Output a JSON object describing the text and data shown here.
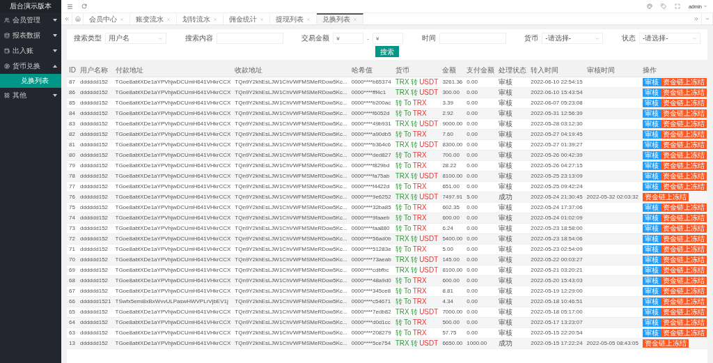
{
  "sidebar": {
    "title": "后台演示版本",
    "items": [
      {
        "label": "会员管理",
        "expanded": false
      },
      {
        "label": "报表数据",
        "expanded": false
      },
      {
        "label": "出入账",
        "expanded": false
      },
      {
        "label": "货币兑换",
        "expanded": true,
        "children": [
          {
            "label": "兑换列表",
            "selected": true
          }
        ]
      },
      {
        "label": "其他",
        "expanded": false
      }
    ]
  },
  "topbar": {
    "user": "admin"
  },
  "tabs": [
    {
      "label": "会员中心",
      "selected": false
    },
    {
      "label": "账变流水",
      "selected": false
    },
    {
      "label": "划转流水",
      "selected": false
    },
    {
      "label": "佣金统计",
      "selected": false
    },
    {
      "label": "提现列表",
      "selected": false
    },
    {
      "label": "兑换列表",
      "selected": true
    }
  ],
  "filters": [
    {
      "kind": "select",
      "label": "搜索类型",
      "value": "用户名"
    },
    {
      "kind": "input",
      "label": "搜索内容"
    },
    {
      "kind": "range",
      "label": "交易金额",
      "placeholders": [
        "¥",
        "¥"
      ],
      "separator": "-"
    },
    {
      "kind": "input",
      "label": "时间"
    },
    {
      "kind": "select",
      "label": "货币",
      "value": "-请选择-"
    },
    {
      "kind": "select",
      "label": "状态",
      "value": "-请选择-"
    }
  ],
  "search_button": "搜索",
  "table": {
    "columns": [
      "ID",
      "用户名称",
      "付款地址",
      "收款地址",
      "哈希值",
      "货币",
      "金额",
      "支付金额",
      "处理状态",
      "转入时间",
      "审核时间",
      "操作"
    ],
    "rows": [
      {
        "id": "87",
        "user": "dddddd152",
        "pay": "TGoe8abtXDe1aYPVhjwDCUmH641VHkrCCX",
        "recv": "TQn9Y2khEsLJW1ChVWFMSMeRDow5Kc...",
        "hash": "0000****b65374",
        "currency": [
          "TRX",
          "转",
          "USDT"
        ],
        "amount": "3261.36",
        "paid": "0.00",
        "status": "审核",
        "in_time": "2022-06-10 22:54:15",
        "audit_time": "",
        "actions": [
          {
            "kind": "primary",
            "label": "审核"
          },
          {
            "kind": "danger",
            "label": "资金链上冻结"
          }
        ]
      },
      {
        "id": "86",
        "user": "dddddd152",
        "pay": "TGoe8abtXDe1aYPVhjwDCUmH641VHkrCCX",
        "recv": "TQn9Y2khEsLJW1ChVWFMSMeRDow5Kc...",
        "hash": "0000****fff4c1",
        "currency": [
          "TRX",
          "转",
          "USDT"
        ],
        "amount": "300.00",
        "paid": "0.00",
        "status": "审核",
        "in_time": "2022-06-10 15:43:54",
        "audit_time": "",
        "actions": [
          {
            "kind": "primary",
            "label": "审核"
          },
          {
            "kind": "danger",
            "label": "资金链上冻结"
          }
        ]
      },
      {
        "id": "85",
        "user": "dddddd152",
        "pay": "TGoe8abtXDe1aYPVhjwDCUmH641VHkrCCX",
        "recv": "TQn9Y2khEsLJW1ChVWFMSMeRDow5Kc...",
        "hash": "0000****b200ac",
        "currency": [
          "转",
          "To",
          "TRX"
        ],
        "amount": "3.39",
        "paid": "0.00",
        "status": "审核",
        "in_time": "2022-06-07 05:23:08",
        "audit_time": "",
        "actions": [
          {
            "kind": "primary",
            "label": "审核"
          },
          {
            "kind": "danger",
            "label": "资金链上冻结"
          }
        ]
      },
      {
        "id": "84",
        "user": "dddddd152",
        "pay": "TGoe8abtXDe1aYPVhjwDCUmH641VHkrCCX",
        "recv": "TQn9Y2khEsLJW1ChVWFMSMeRDow5Kc...",
        "hash": "0000****f6052d",
        "currency": [
          "转",
          "To",
          "TRX"
        ],
        "amount": "2.92",
        "paid": "0.00",
        "status": "审核",
        "in_time": "2022-05-31 12:56:39",
        "audit_time": "",
        "actions": [
          {
            "kind": "primary",
            "label": "审核"
          },
          {
            "kind": "danger",
            "label": "资金链上冻结"
          }
        ]
      },
      {
        "id": "83",
        "user": "dddddd152",
        "pay": "TGoe8abtXDe1aYPVhjwDCUmH641VHkrCCX",
        "recv": "TQn9Y2khEsLJW1ChVWFMSMeRDow5Kc...",
        "hash": "0000****49b931",
        "currency": [
          "TRX",
          "转",
          "USDT"
        ],
        "amount": "9000.00",
        "paid": "0.00",
        "status": "审核",
        "in_time": "2022-05-28 03:12:30",
        "audit_time": "",
        "actions": [
          {
            "kind": "primary",
            "label": "审核"
          },
          {
            "kind": "danger",
            "label": "资金链上冻结"
          }
        ]
      },
      {
        "id": "82",
        "user": "dddddd152",
        "pay": "TGoe8abtXDe1aYPVhjwDCUmH641VHkrCCX",
        "recv": "TQn9Y2khEsLJW1ChVWFMSMeRDow5Kc...",
        "hash": "0000****a90db5",
        "currency": [
          "转",
          "To",
          "TRX"
        ],
        "amount": "7.60",
        "paid": "0.00",
        "status": "审核",
        "in_time": "2022-05-27 04:19:45",
        "audit_time": "",
        "actions": [
          {
            "kind": "primary",
            "label": "审核"
          },
          {
            "kind": "danger",
            "label": "资金链上冻结"
          }
        ]
      },
      {
        "id": "81",
        "user": "dddddd152",
        "pay": "TGoe8abtXDe1aYPVhjwDCUmH641VHkrCCX",
        "recv": "TQn9Y2khEsLJW1ChVWFMSMeRDow5Kc...",
        "hash": "0000****b364c6",
        "currency": [
          "TRX",
          "转",
          "USDT"
        ],
        "amount": "8300.00",
        "paid": "0.00",
        "status": "审核",
        "in_time": "2022-05-27 01:39:27",
        "audit_time": "",
        "actions": [
          {
            "kind": "primary",
            "label": "审核"
          },
          {
            "kind": "danger",
            "label": "资金链上冻结"
          }
        ]
      },
      {
        "id": "80",
        "user": "dddddd152",
        "pay": "TGoe8abtXDe1aYPVhjwDCUmH641VHkrCCX",
        "recv": "TQn9Y2khEsLJW1ChVWFMSMeRDow5Kc...",
        "hash": "0000****ded827",
        "currency": [
          "转",
          "To",
          "TRX"
        ],
        "amount": "700.00",
        "paid": "0.00",
        "status": "审核",
        "in_time": "2022-05-26 00:42:39",
        "audit_time": "",
        "actions": [
          {
            "kind": "primary",
            "label": "审核"
          },
          {
            "kind": "danger",
            "label": "资金链上冻结"
          }
        ]
      },
      {
        "id": "79",
        "user": "dddddd152",
        "pay": "TGoe8abtXDe1aYPVhjwDCUmH641VHkrCCX",
        "recv": "TQn9Y2khEsLJW1ChVWFMSMeRDow5Kc...",
        "hash": "0000****f829bd",
        "currency": [
          "转",
          "To",
          "TRX"
        ],
        "amount": "28.22",
        "paid": "0.00",
        "status": "审核",
        "in_time": "2022-05-26 04:27:15",
        "audit_time": "",
        "actions": [
          {
            "kind": "primary",
            "label": "审核"
          },
          {
            "kind": "danger",
            "label": "资金链上冻结"
          }
        ]
      },
      {
        "id": "78",
        "user": "dddddd152",
        "pay": "TGoe8abtXDe1aYPVhjwDCUmH641VHkrCCX",
        "recv": "TQn9Y2khEsLJW1ChVWFMSMeRDow5Kc...",
        "hash": "0000****fa75ab",
        "currency": [
          "TRX",
          "转",
          "USDT"
        ],
        "amount": "8100.00",
        "paid": "0.00",
        "status": "审核",
        "in_time": "2022-05-25 23:13:09",
        "audit_time": "",
        "actions": [
          {
            "kind": "primary",
            "label": "审核"
          },
          {
            "kind": "danger",
            "label": "资金链上冻结"
          }
        ]
      },
      {
        "id": "77",
        "user": "dddddd152",
        "pay": "TGoe8abtXDe1aYPVhjwDCUmH641VHkrCCX",
        "recv": "TQn9Y2khEsLJW1ChVWFMSMeRDow5Kc...",
        "hash": "0000****f4422d",
        "currency": [
          "转",
          "To",
          "TRX"
        ],
        "amount": "651.00",
        "paid": "0.00",
        "status": "审核",
        "in_time": "2022-05-25 09:42:24",
        "audit_time": "",
        "actions": [
          {
            "kind": "primary",
            "label": "审核"
          },
          {
            "kind": "danger",
            "label": "资金链上冻结"
          }
        ]
      },
      {
        "id": "76",
        "user": "dddddd152",
        "pay": "TGoe8abtXDe1aYPVhjwDCUmH641VHkrCCX",
        "recv": "TQn9Y2khEsLJW1ChVWFMSMeRDow5Kc...",
        "hash": "0000****9e6252",
        "currency": [
          "TRX",
          "转",
          "USDT"
        ],
        "amount": "7497.91",
        "paid": "5.00",
        "status": "成功",
        "in_time": "2022-05-24 21:30:45",
        "audit_time": "2022-05-32 02:03:32",
        "actions": [
          {
            "kind": "danger",
            "label": "资金链上冻结"
          }
        ]
      },
      {
        "id": "75",
        "user": "dddddd152",
        "pay": "TGoe8abtXDe1aYPVhjwDCUmH641VHkrCCX",
        "recv": "TQn9Y2khEsLJW1ChVWFMSMeRDow5Kc...",
        "hash": "0000****32ba85",
        "currency": [
          "转",
          "To",
          "TRX"
        ],
        "amount": "602.35",
        "paid": "0.00",
        "status": "审核",
        "in_time": "2022-05-24 17:37:06",
        "audit_time": "",
        "actions": [
          {
            "kind": "primary",
            "label": "审核"
          },
          {
            "kind": "danger",
            "label": "资金链上冻结"
          }
        ]
      },
      {
        "id": "74",
        "user": "dddddd152",
        "pay": "TGoe8abtXDe1aYPVhjwDCUmH641VHkrCCX",
        "recv": "TQn9Y2khEsLJW1ChVWFMSMeRDow5Kc...",
        "hash": "0000****9faaeb",
        "currency": [
          "转",
          "To",
          "TRX"
        ],
        "amount": "600.00",
        "paid": "0.00",
        "status": "审核",
        "in_time": "2022-05-24 01:02:09",
        "audit_time": "",
        "actions": [
          {
            "kind": "primary",
            "label": "审核"
          },
          {
            "kind": "danger",
            "label": "资金链上冻结"
          }
        ]
      },
      {
        "id": "73",
        "user": "dddddd152",
        "pay": "TGoe8abtXDe1aYPVhjwDCUmH641VHkrCCX",
        "recv": "TQn9Y2khEsLJW1ChVWFMSMeRDow5Kc...",
        "hash": "0000****faa880",
        "currency": [
          "转",
          "To",
          "TRX"
        ],
        "amount": "6.24",
        "paid": "0.00",
        "status": "审核",
        "in_time": "2022-05-23 18:58:00",
        "audit_time": "",
        "actions": [
          {
            "kind": "primary",
            "label": "审核"
          },
          {
            "kind": "danger",
            "label": "资金链上冻结"
          }
        ]
      },
      {
        "id": "72",
        "user": "dddddd152",
        "pay": "TGoe8abtXDe1aYPVhjwDCUmH641VHkrCCX",
        "recv": "TQn9Y2khEsLJW1ChVWFMSMeRDow5Kc...",
        "hash": "0000****56ad0b",
        "currency": [
          "TRX",
          "转",
          "USDT"
        ],
        "amount": "5400.00",
        "paid": "0.00",
        "status": "审核",
        "in_time": "2022-05-23 18:54:06",
        "audit_time": "",
        "actions": [
          {
            "kind": "primary",
            "label": "审核"
          },
          {
            "kind": "danger",
            "label": "资金链上冻结"
          }
        ]
      },
      {
        "id": "71",
        "user": "dddddd152",
        "pay": "TGoe8abtXDe1aYPVhjwDCUmH641VHkrCCX",
        "recv": "TQn9Y2khEsLJW1ChVWFMSMeRDow5Kc...",
        "hash": "0000****51283e",
        "currency": [
          "转",
          "To",
          "TRX"
        ],
        "amount": "5.00",
        "paid": "0.00",
        "status": "审核",
        "in_time": "2022-05-23 02:54:09",
        "audit_time": "",
        "actions": [
          {
            "kind": "primary",
            "label": "审核"
          },
          {
            "kind": "danger",
            "label": "资金链上冻结"
          }
        ]
      },
      {
        "id": "70",
        "user": "dddddd152",
        "pay": "TGoe8abtXDe1aYPVhjwDCUmH641VHkrCCX",
        "recv": "TQn9Y2khEsLJW1ChVWFMSMeRDow5Kc...",
        "hash": "0000****73aeab",
        "currency": [
          "TRX",
          "转",
          "USDT"
        ],
        "amount": "145.00",
        "paid": "0.00",
        "status": "审核",
        "in_time": "2022-05-22 00:03:27",
        "audit_time": "",
        "actions": [
          {
            "kind": "primary",
            "label": "审核"
          },
          {
            "kind": "danger",
            "label": "资金链上冻结"
          }
        ]
      },
      {
        "id": "69",
        "user": "dddddd152",
        "pay": "TGoe8abtXDe1aYPVhjwDCUmH641VHkrCCX",
        "recv": "TQn9Y2khEsLJW1ChVWFMSMeRDow5Kc...",
        "hash": "0000****cdbfbc",
        "currency": [
          "TRX",
          "转",
          "USDT"
        ],
        "amount": "8100.00",
        "paid": "0.00",
        "status": "审核",
        "in_time": "2022-05-21 03:20:21",
        "audit_time": "",
        "actions": [
          {
            "kind": "primary",
            "label": "审核"
          },
          {
            "kind": "danger",
            "label": "资金链上冻结"
          }
        ]
      },
      {
        "id": "68",
        "user": "dddddd152",
        "pay": "TGoe8abtXDe1aYPVhjwDCUmH641VHkrCCX",
        "recv": "TQn9Y2khEsLJW1ChVWFMSMeRDow5Kc...",
        "hash": "0000****48a9d0",
        "currency": [
          "转",
          "To",
          "TRX"
        ],
        "amount": "600.00",
        "paid": "0.00",
        "status": "审核",
        "in_time": "2022-05-20 15:43:03",
        "audit_time": "",
        "actions": [
          {
            "kind": "primary",
            "label": "审核"
          },
          {
            "kind": "danger",
            "label": "资金链上冻结"
          }
        ]
      },
      {
        "id": "67",
        "user": "dddddd152",
        "pay": "TGoe8abtXDe1aYPVhjwDCUmH641VHkrCCX",
        "recv": "TQn9Y2khEsLJW1ChVWFMSMeRDow5Kc...",
        "hash": "0000****345ce8",
        "currency": [
          "转",
          "To",
          "TRX"
        ],
        "amount": "8.81",
        "paid": "0.00",
        "status": "审核",
        "in_time": "2022-05-19 12:29:00",
        "audit_time": "",
        "actions": [
          {
            "kind": "primary",
            "label": "审核"
          },
          {
            "kind": "danger",
            "label": "资金链上冻结"
          }
        ]
      },
      {
        "id": "66",
        "user": "dddddd1521",
        "pay": "TSwfx5emi8xBxWvvULPaswHWVPLrVjbEV1j",
        "recv": "TQn9Y2khEsLJW1ChVWFMSMeRDow5Kc...",
        "hash": "0000****c54671",
        "currency": [
          "转",
          "To",
          "TRX"
        ],
        "amount": "4.34",
        "paid": "0.00",
        "status": "审核",
        "in_time": "2022-05-18 10:46:51",
        "audit_time": "",
        "actions": [
          {
            "kind": "primary",
            "label": "审核"
          },
          {
            "kind": "danger",
            "label": "资金链上冻结"
          }
        ]
      },
      {
        "id": "65",
        "user": "dddddd152",
        "pay": "TGoe8abtXDe1aYPVhjwDCUmH641VHkrCCX",
        "recv": "TQn9Y2khEsLJW1ChVWFMSMeRDow5Kc...",
        "hash": "0000****7edb82",
        "currency": [
          "TRX",
          "转",
          "USDT"
        ],
        "amount": "7000.00",
        "paid": "0.00",
        "status": "审核",
        "in_time": "2022-05-18 05:17:00",
        "audit_time": "",
        "actions": [
          {
            "kind": "primary",
            "label": "审核"
          },
          {
            "kind": "danger",
            "label": "资金链上冻结"
          }
        ]
      },
      {
        "id": "64",
        "user": "dddddd152",
        "pay": "TGoe8abtXDe1aYPVhjwDCUmH641VHkrCCX",
        "recv": "TQn9Y2khEsLJW1ChVWFMSMeRDow5Kc...",
        "hash": "0000****d0d1cc",
        "currency": [
          "转",
          "To",
          "TRX"
        ],
        "amount": "500.00",
        "paid": "0.00",
        "status": "审核",
        "in_time": "2022-05-17 13:23:07",
        "audit_time": "",
        "actions": [
          {
            "kind": "primary",
            "label": "审核"
          },
          {
            "kind": "danger",
            "label": "资金链上冻结"
          }
        ]
      },
      {
        "id": "63",
        "user": "dddddd152",
        "pay": "TGoe8abtXDe1aYPVhjwDCUmH641VHkrCCX",
        "recv": "TQn9Y2khEsLJW1ChVWFMSMeRDow5Kc...",
        "hash": "0000****208279",
        "currency": [
          "转",
          "To",
          "TRX"
        ],
        "amount": "57.75",
        "paid": "0.00",
        "status": "审核",
        "in_time": "2022-05-15 22:20:54",
        "audit_time": "",
        "actions": [
          {
            "kind": "primary",
            "label": "审核"
          },
          {
            "kind": "danger",
            "label": "资金链上冻结"
          }
        ]
      },
      {
        "id": "13",
        "user": "dddddd152",
        "pay": "TGoe8abtXDe1aYPVhjwDCUmH641VHkrCCX",
        "recv": "TQn9Y2khEsLJW1ChVWFMSMeRDow5Kc...",
        "hash": "0000****5ce754",
        "currency": [
          "TRX",
          "转",
          "USDT"
        ],
        "amount": "6650.00",
        "paid": "1000.00",
        "status": "成功",
        "in_time": "2022-05-15 17:22:24",
        "audit_time": "2022-05-05 08:43:05",
        "actions": [
          {
            "kind": "danger",
            "label": "资金链上冻结"
          }
        ]
      }
    ]
  }
}
